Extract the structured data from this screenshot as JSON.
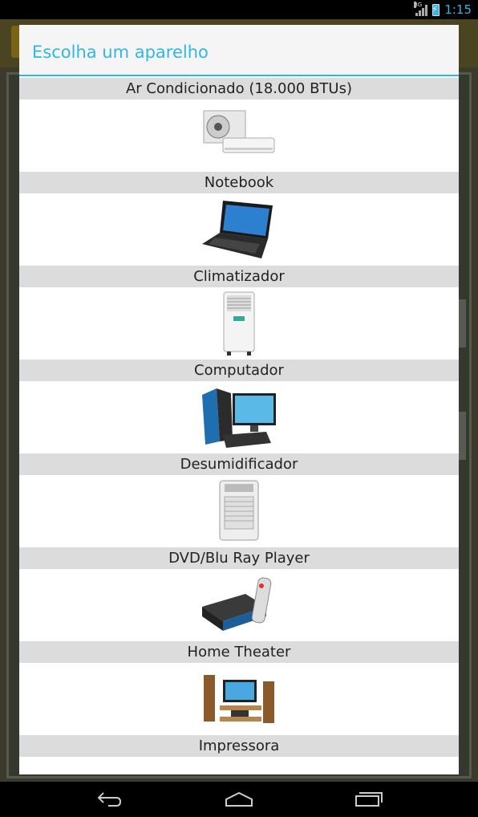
{
  "status_bar": {
    "network": "3G",
    "time": "1:15"
  },
  "dialog": {
    "title": "Escolha um aparelho"
  },
  "appliances": [
    {
      "label": "Ar Condicionado (18.000 BTUs)",
      "icon": "air-conditioner-icon"
    },
    {
      "label": "Notebook",
      "icon": "air-conditioner-icon"
    },
    {
      "label": "Climatizador",
      "icon": "laptop-icon"
    },
    {
      "label": "Computador",
      "icon": "air-cooler-icon"
    },
    {
      "label": "Desumidificador",
      "icon": "desktop-computer-icon"
    },
    {
      "label": "DVD/Blu Ray Player",
      "icon": "dehumidifier-icon"
    },
    {
      "label": "Home Theater",
      "icon": "dvd-player-icon"
    },
    {
      "label": "Impressora",
      "icon": "home-theater-icon"
    }
  ],
  "nav": {
    "back": "back-icon",
    "home": "home-icon",
    "recents": "recents-icon"
  },
  "colors": {
    "accent": "#33b5e5",
    "separator": "#dcdcdc"
  }
}
